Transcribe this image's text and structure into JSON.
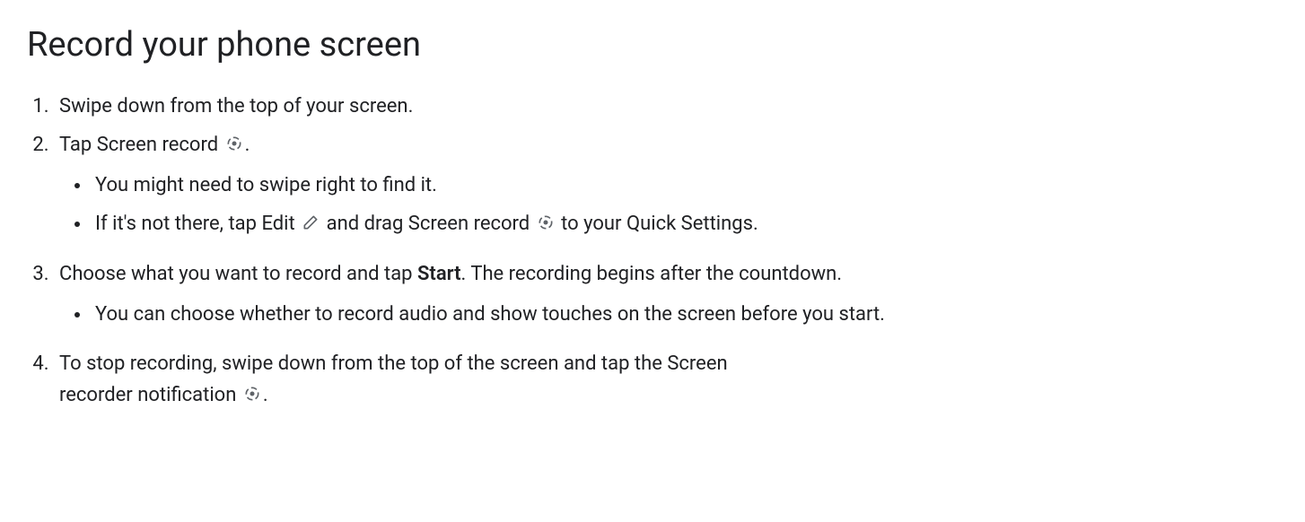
{
  "title": "Record your phone screen",
  "step1": "Swipe down from the top of your screen.",
  "step2_a": "Tap Screen record ",
  "step2_b": ".",
  "step2_sub1": "You might need to swipe right to find it.",
  "step2_sub2_a": "If it's not there, tap Edit ",
  "step2_sub2_b": " and drag Screen record ",
  "step2_sub2_c": " to your Quick Settings.",
  "step3_a": "Choose what you want to record and tap ",
  "step3_strong": "Start",
  "step3_b": ". The recording begins after the countdown.",
  "step3_sub1": "You can choose whether to record audio and show touches on the screen before you start.",
  "step4_a": "To stop recording, swipe down from the top of the screen and tap the Screen recorder notification ",
  "step4_b": "."
}
